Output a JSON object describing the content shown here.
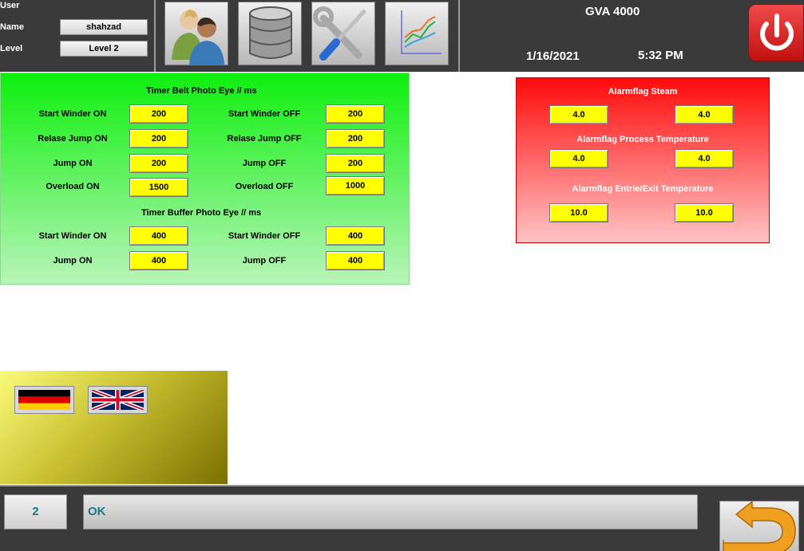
{
  "header": {
    "user_label": "User",
    "name_label": "Name",
    "name_value": "shahzad",
    "level_label": "Level",
    "level_value": "Level 2",
    "app_title": "GVA 4000",
    "date": "1/16/2021",
    "time": "5:32 PM",
    "nav_icons": [
      "users-icon",
      "database-icon",
      "tools-icon",
      "chart-icon"
    ],
    "power_icon": "power-icon"
  },
  "belt": {
    "title": "Timer Belt Photo Eye // ms",
    "rows": [
      {
        "on_label": "Start Winder ON",
        "on_value": "200",
        "off_label": "Start Winder OFF",
        "off_value": "200"
      },
      {
        "on_label": "Relase Jump ON",
        "on_value": "200",
        "off_label": "Relase Jump OFF",
        "off_value": "200"
      },
      {
        "on_label": "Jump ON",
        "on_value": "200",
        "off_label": "Jump OFF",
        "off_value": "200"
      },
      {
        "on_label": "Overload ON",
        "on_value": "1500",
        "off_label": "Overload OFF",
        "off_value": "1000"
      }
    ]
  },
  "buffer": {
    "title": "Timer Buffer Photo Eye // ms",
    "rows": [
      {
        "on_label": "Start Winder ON",
        "on_value": "400",
        "off_label": "Start Winder OFF",
        "off_value": "400"
      },
      {
        "on_label": "Jump ON",
        "on_value": "400",
        "off_label": "Jump OFF",
        "off_value": "400"
      }
    ]
  },
  "alarms": {
    "steam": {
      "title": "Alarmflag Steam",
      "values": [
        "4.0",
        "4.0"
      ]
    },
    "process": {
      "title": "Alarmflag Process Temperature",
      "values": [
        "4.0",
        "4.0"
      ]
    },
    "entry_exit": {
      "title": "Alarmflag Entrie/Exit Temperature",
      "values": [
        "10.0",
        "10.0"
      ]
    }
  },
  "languages": [
    "german-flag-icon",
    "uk-flag-icon"
  ],
  "status": {
    "code": "2",
    "message": "OK",
    "back_icon": "back-arrow-icon"
  },
  "colors": {
    "field_yellow": "#ffff00",
    "panel_green": "#0ef00e",
    "panel_red": "#ff0a0a",
    "status_text": "#1a7a80"
  }
}
